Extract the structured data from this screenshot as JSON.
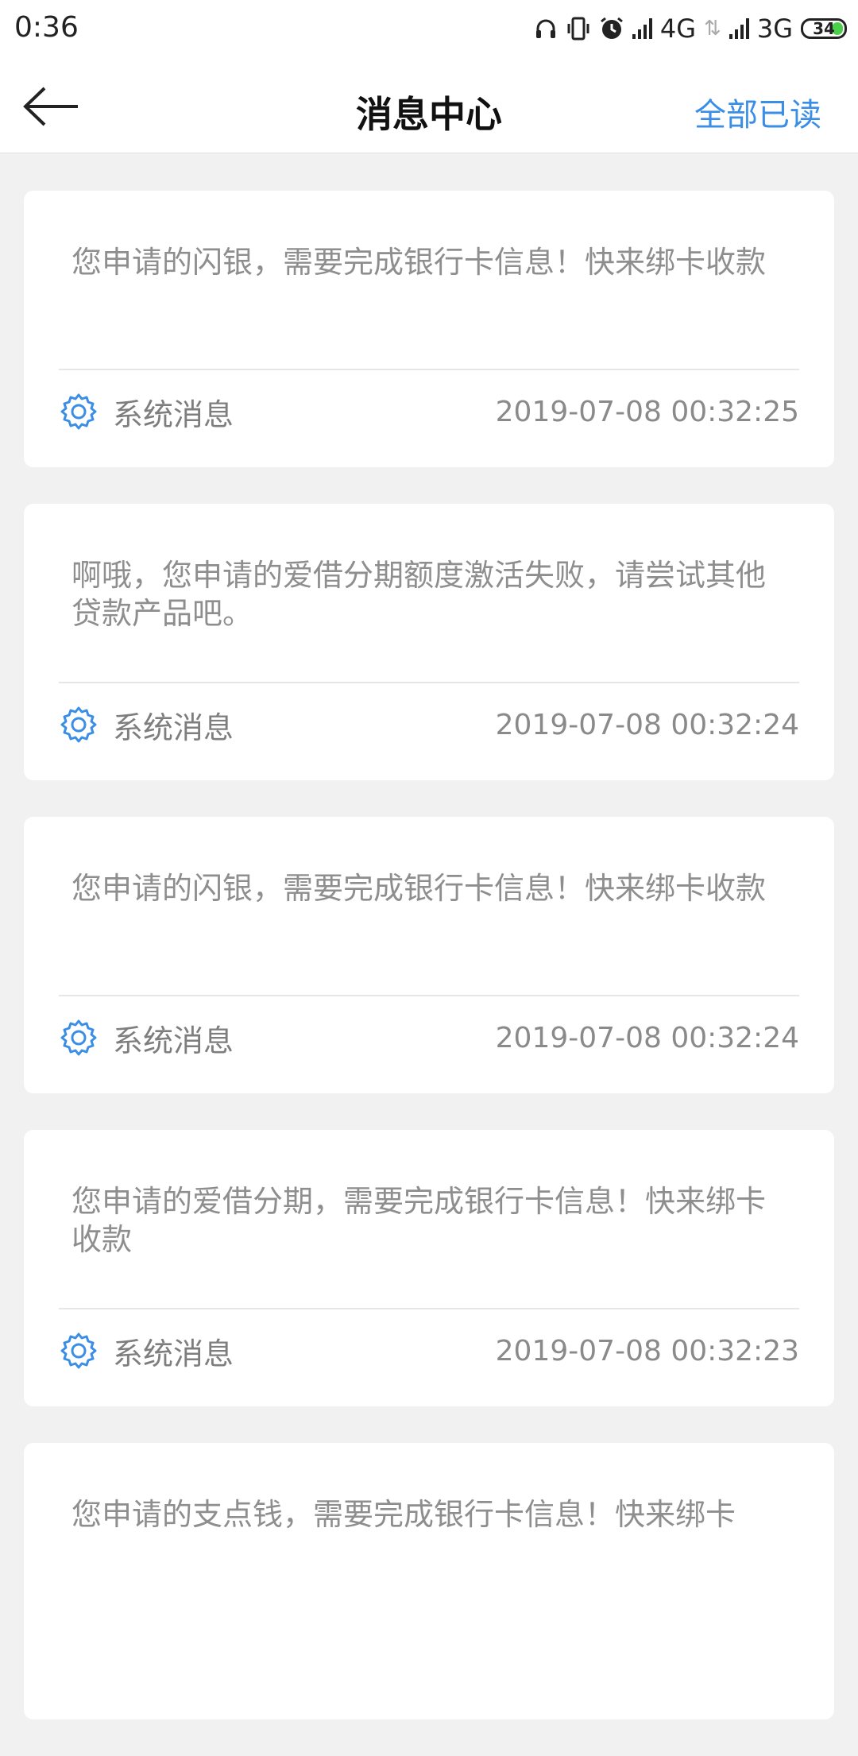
{
  "status_bar": {
    "time": "0:36",
    "network_1": "4G",
    "network_2": "3G",
    "battery": "34",
    "icons": [
      "headphones-icon",
      "vibrate-icon",
      "alarm-icon",
      "hd-signal-icon",
      "data-arrows-icon",
      "signal-icon",
      "battery-icon"
    ]
  },
  "header": {
    "title": "消息中心",
    "mark_all_read": "全部已读",
    "back_icon": "back-arrow-icon"
  },
  "messages": [
    {
      "text": "您申请的闪银，需要完成银行卡信息！快来绑卡收款",
      "type": "系统消息",
      "time": "2019-07-08 00:32:25"
    },
    {
      "text": "啊哦，您申请的爱借分期额度激活失败，请尝试其他贷款产品吧。",
      "type": "系统消息",
      "time": "2019-07-08 00:32:24"
    },
    {
      "text": "您申请的闪银，需要完成银行卡信息！快来绑卡收款",
      "type": "系统消息",
      "time": "2019-07-08 00:32:24"
    },
    {
      "text": "您申请的爱借分期，需要完成银行卡信息！快来绑卡收款",
      "type": "系统消息",
      "time": "2019-07-08 00:32:23"
    },
    {
      "text": "您申请的支点钱，需要完成银行卡信息！快来绑卡",
      "type": "",
      "time": ""
    }
  ],
  "colors": {
    "accent": "#3a8ee6",
    "background": "#f1f1f1",
    "card": "#ffffff",
    "text_muted": "#8e8e8e"
  }
}
